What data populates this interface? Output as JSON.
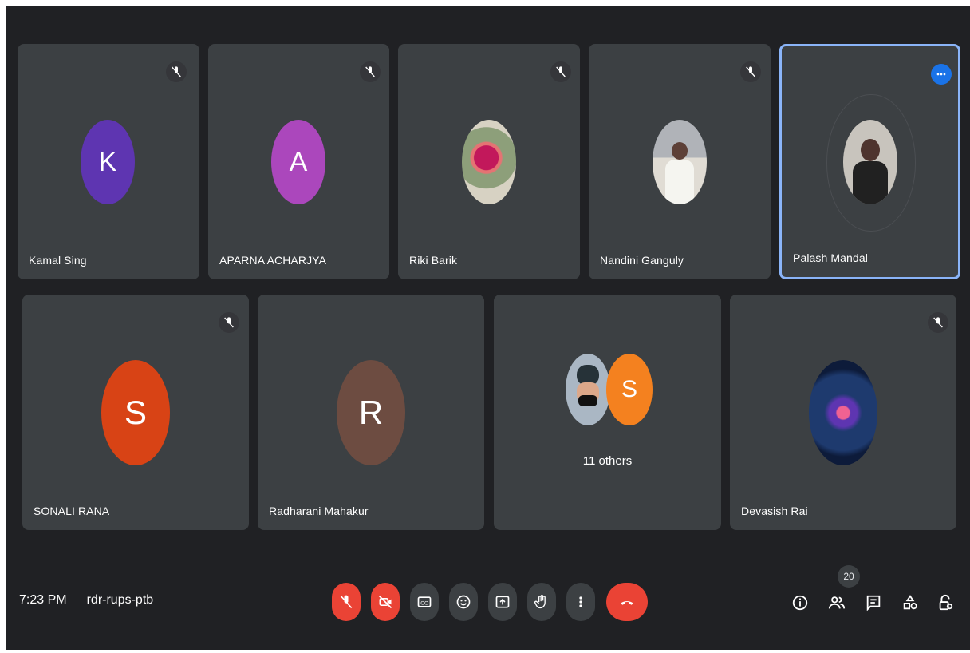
{
  "participants_row1": [
    {
      "name": "Kamal Sing",
      "initial": "K",
      "avatar_color": "#5e35b1",
      "muted": true
    },
    {
      "name": "APARNA ACHARJYA",
      "initial": "A",
      "avatar_color": "#ab47bc",
      "muted": true
    },
    {
      "name": "Riki Barik",
      "initial": "",
      "avatar_type": "photo-flower",
      "muted": true
    },
    {
      "name": "Nandini Ganguly",
      "initial": "",
      "avatar_type": "photo-person",
      "muted": true
    },
    {
      "name": "Palash Mandal",
      "initial": "",
      "avatar_type": "photo-person",
      "muted": false,
      "speaking": true,
      "more_options_icon": "more-horiz-icon"
    }
  ],
  "participants_row2": [
    {
      "name": "SONALI RANA",
      "initial": "S",
      "avatar_color": "#d84315",
      "muted": true
    },
    {
      "name": "Radharani Mahakur",
      "initial": "R",
      "avatar_color": "#6d4c41",
      "muted": false
    },
    {
      "name": "",
      "others_label": "11 others",
      "extra_initial": "S",
      "extra_color": "#f4811f",
      "muted": false
    },
    {
      "name": "Devasish Rai",
      "initial": "",
      "avatar_type": "photo-abstract",
      "muted": true
    }
  ],
  "meeting": {
    "time": "7:23 PM",
    "code": "rdr-rups-ptb"
  },
  "controls": [
    {
      "icon": "mic-off-icon",
      "state": "off",
      "color": "#ea4335"
    },
    {
      "icon": "camera-off-icon",
      "state": "off",
      "color": "#ea4335"
    },
    {
      "icon": "captions-icon"
    },
    {
      "icon": "emoji-icon"
    },
    {
      "icon": "present-icon"
    },
    {
      "icon": "raise-hand-icon"
    },
    {
      "icon": "more-vert-icon"
    },
    {
      "icon": "leave-call-icon",
      "color": "#ea4335"
    }
  ],
  "right_tools": {
    "participant_count": "20",
    "icons": [
      "info-icon",
      "people-icon",
      "chat-icon",
      "activities-icon",
      "host-controls-icon"
    ]
  }
}
